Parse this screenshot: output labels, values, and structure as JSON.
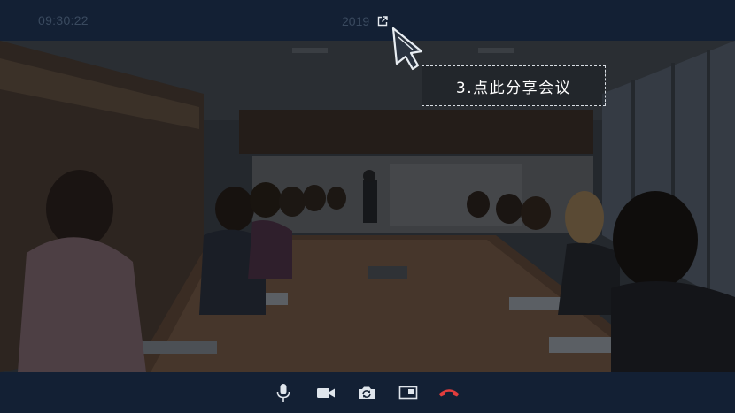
{
  "header": {
    "clock": "09:30:22",
    "meeting_id": "2019",
    "share_icon": "external-link-icon"
  },
  "video": {
    "scene": "conference-room-meeting",
    "overlay_dim": true
  },
  "toolbar": {
    "items": [
      {
        "name": "mute",
        "icon": "microphone-icon"
      },
      {
        "name": "camera",
        "icon": "video-camera-icon"
      },
      {
        "name": "switch-camera",
        "icon": "camera-rotate-icon"
      },
      {
        "name": "screen",
        "icon": "picture-in-picture-icon"
      },
      {
        "name": "hangup",
        "icon": "phone-hangup-icon",
        "color": "#e23d3d"
      }
    ]
  },
  "guide": {
    "tooltip_text": "3.点此分享会议",
    "pointer_icon": "hand-pointer-icon"
  },
  "colors": {
    "bar_background": "#132034",
    "dim_text": "#3a4a5f",
    "icon_color": "#dfe5ec",
    "hangup_red": "#e23d3d"
  }
}
